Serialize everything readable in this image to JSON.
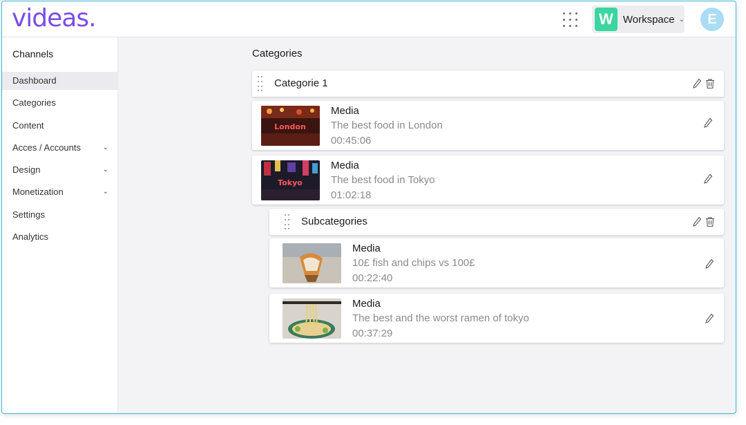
{
  "app": {
    "logo": "videas."
  },
  "header": {
    "workspace_initial": "W",
    "workspace_label": "Workspace",
    "avatar_initial": "E"
  },
  "sidebar": {
    "title": "Channels",
    "items": [
      {
        "label": "Dashboard",
        "active": true,
        "chevron": false
      },
      {
        "label": "Categories",
        "active": false,
        "chevron": false
      },
      {
        "label": "Content",
        "active": false,
        "chevron": false
      },
      {
        "label": "Acces / Accounts",
        "active": false,
        "chevron": true
      },
      {
        "label": "Design",
        "active": false,
        "chevron": true
      },
      {
        "label": "Monetization",
        "active": false,
        "chevron": true
      },
      {
        "label": "Settings",
        "active": false,
        "chevron": false
      },
      {
        "label": "Analytics",
        "active": false,
        "chevron": false
      }
    ]
  },
  "main": {
    "title": "Categories",
    "category": {
      "label": "Categorie 1"
    },
    "media": [
      {
        "type": "Media",
        "title": "The best food in London",
        "duration": "00:45:06",
        "thumb_overlay": "London"
      },
      {
        "type": "Media",
        "title": "The best food in Tokyo",
        "duration": "01:02:18",
        "thumb_overlay": "Tokyo"
      }
    ],
    "subcategory": {
      "label": "Subcategories"
    },
    "sub_media": [
      {
        "type": "Media",
        "title": "10£ fish and chips vs 100£",
        "duration": "00:22:40"
      },
      {
        "type": "Media",
        "title": "The best and the worst ramen of tokyo",
        "duration": "00:37:29"
      }
    ]
  },
  "colors": {
    "brand": "#7a4de6",
    "workspace_badge": "#3ad6a0",
    "avatar": "#a9dcf5",
    "frame_border": "#3bb4d6"
  }
}
